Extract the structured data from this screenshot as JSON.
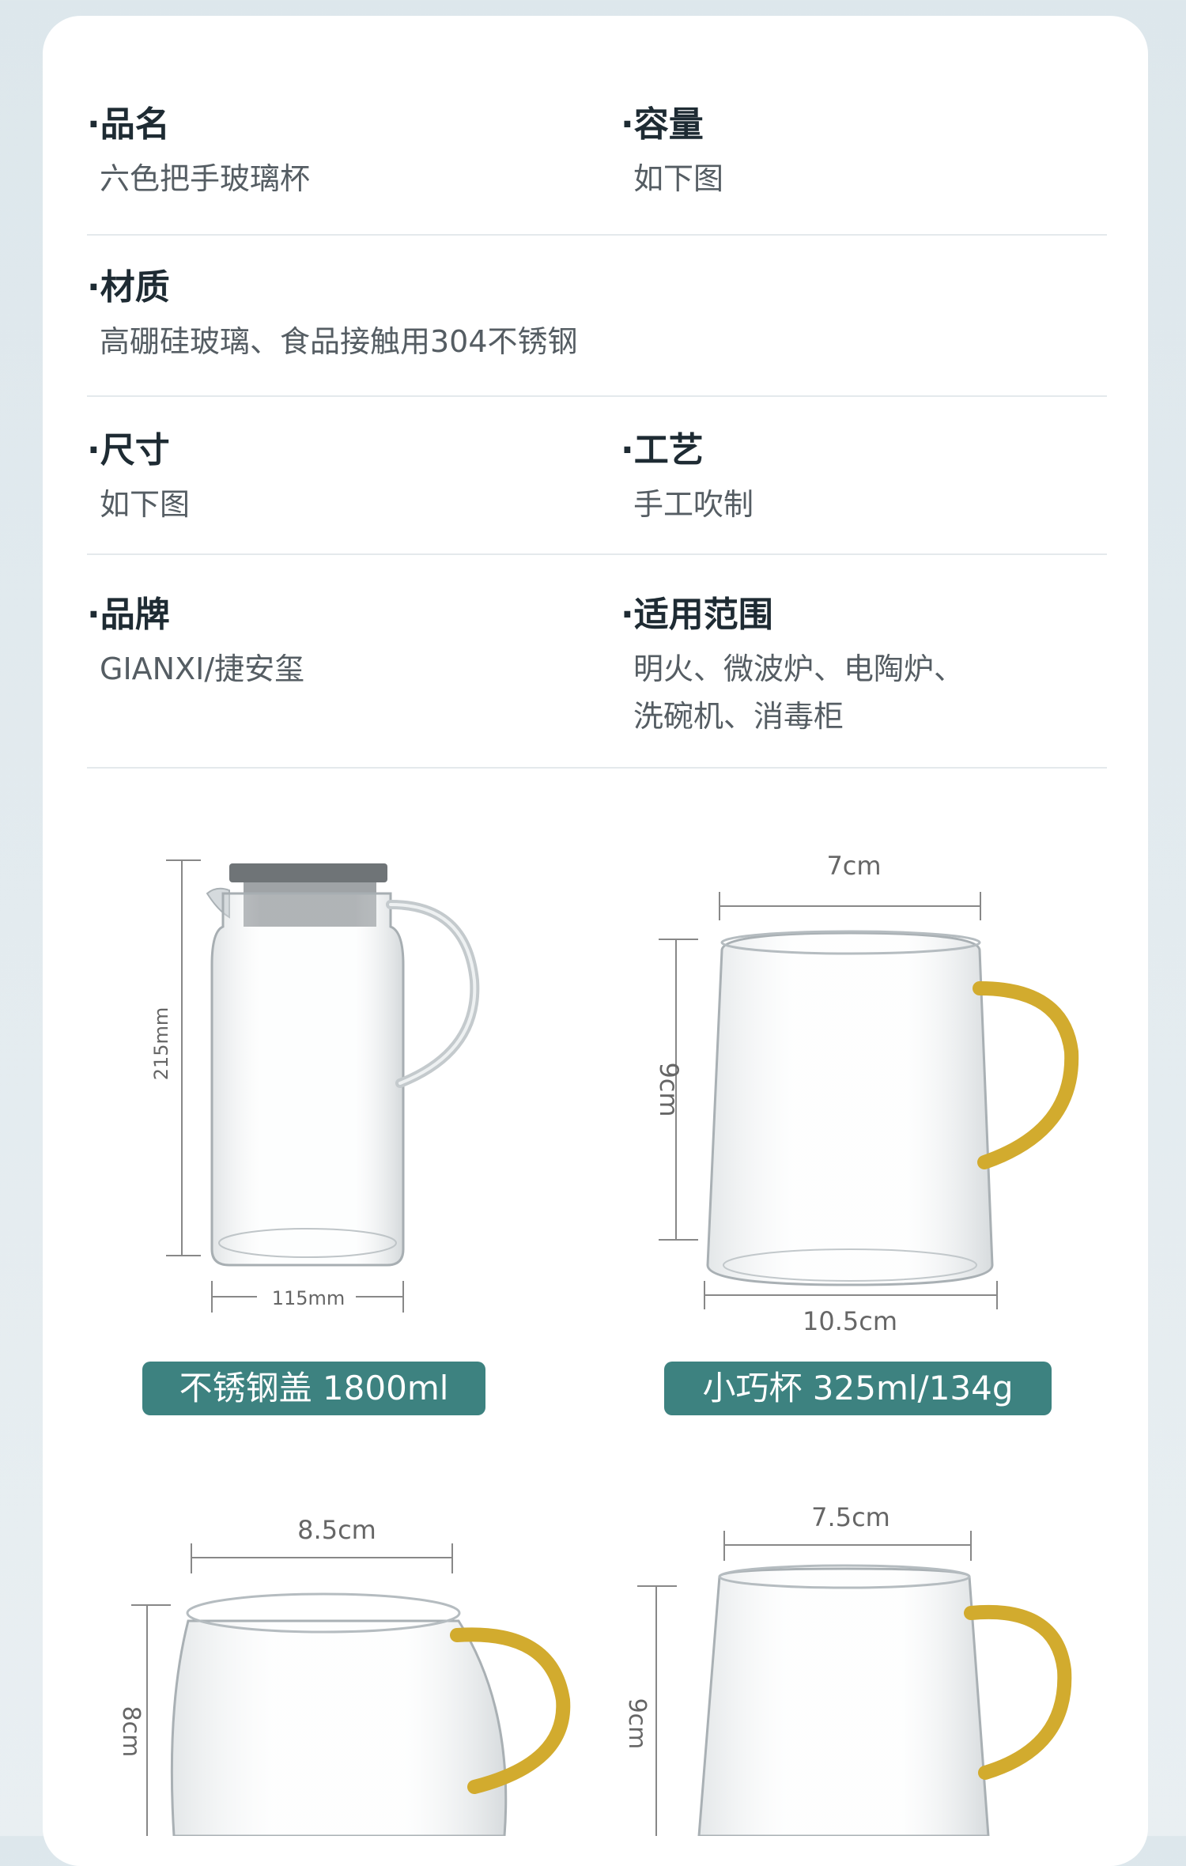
{
  "specs": {
    "name": {
      "label": "·品名",
      "value": "六色把手玻璃杯"
    },
    "capacity": {
      "label": "·容量",
      "value": "如下图"
    },
    "material": {
      "label": "·材质",
      "value": "高硼硅玻璃、食品接触用304不锈钢"
    },
    "size": {
      "label": "·尺寸",
      "value": "如下图"
    },
    "craft": {
      "label": "·工艺",
      "value": "手工吹制"
    },
    "brand": {
      "label": "·品牌",
      "value": "GIANXI/捷安玺"
    },
    "scope": {
      "label": "·适用范围",
      "value_line1": "明火、微波炉、电陶炉、",
      "value_line2": "洗碗机、消毒柜"
    }
  },
  "products": [
    {
      "height_label": "215mm",
      "width_label": "115mm",
      "caption": "不锈钢盖 1800ml"
    },
    {
      "width_label": "7cm",
      "height_label": "9cm",
      "base_label": "10.5cm",
      "caption": "小巧杯 325ml/134g"
    },
    {
      "width_label": "8.5cm",
      "height_label": "8cm"
    },
    {
      "width_label": "7.5cm",
      "height_label": "9cm"
    }
  ],
  "colors": {
    "caption_bg": "#3d8280",
    "handle": "#d2ab2e",
    "lid": "#6f7477"
  }
}
